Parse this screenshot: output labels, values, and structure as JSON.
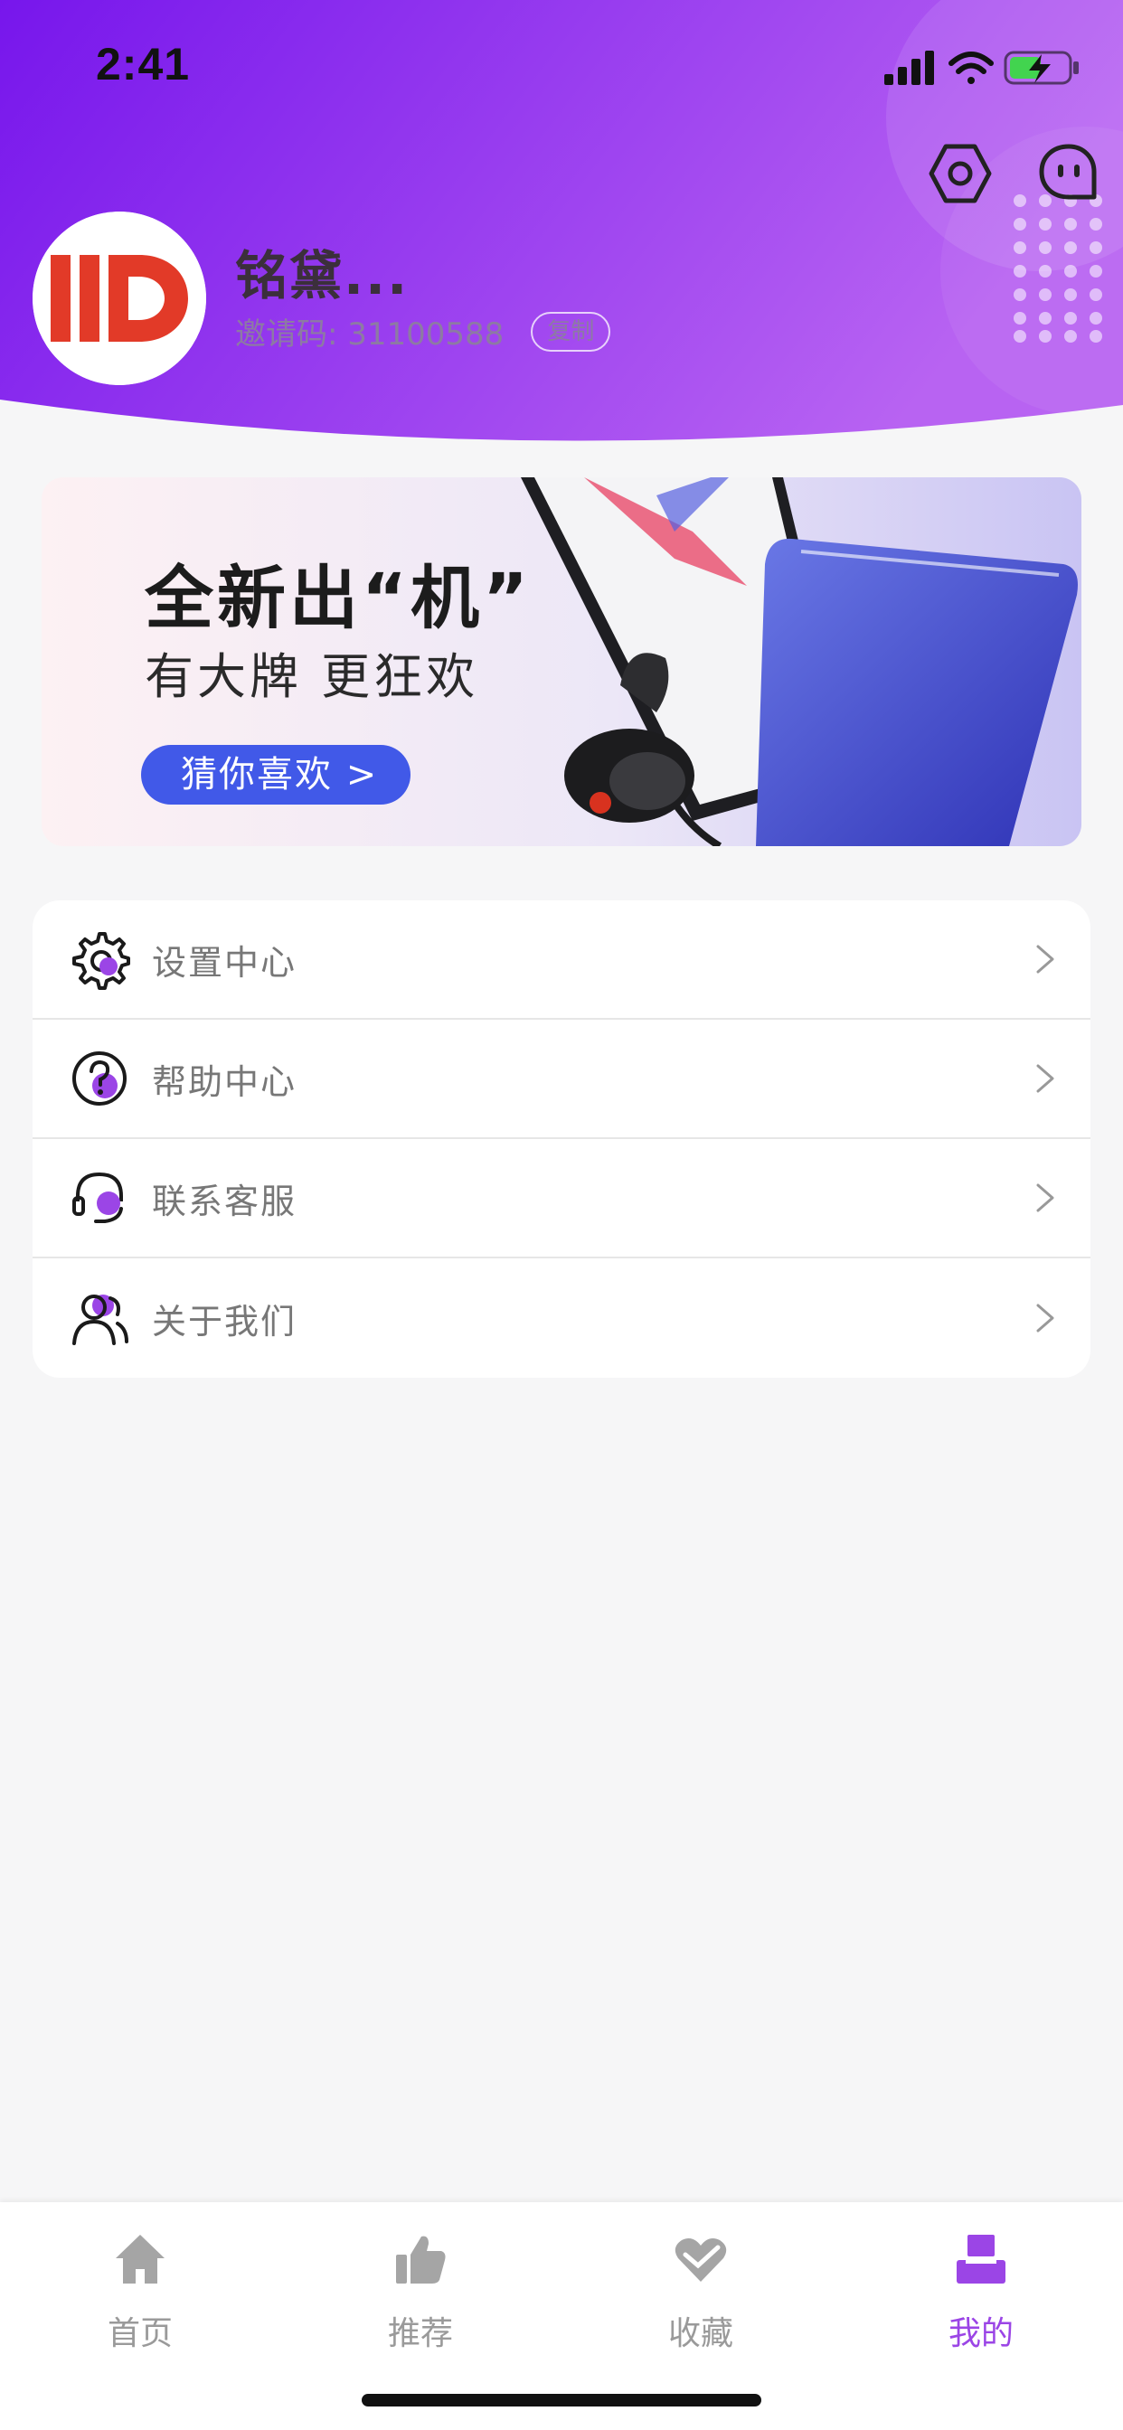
{
  "status_bar": {
    "time": "2:41"
  },
  "profile": {
    "name": "铭黛...",
    "invite_label": "邀请码: 31100588",
    "copy_label": "复制"
  },
  "banner": {
    "title": "全新出“机”",
    "subtitle": "有大牌 更狂欢",
    "button_label": "猜你喜欢 >"
  },
  "menu": {
    "items": [
      {
        "label": "设置中心",
        "icon": "gear-icon"
      },
      {
        "label": "帮助中心",
        "icon": "help-icon"
      },
      {
        "label": "联系客服",
        "icon": "headset-icon"
      },
      {
        "label": "关于我们",
        "icon": "users-icon"
      }
    ]
  },
  "tabbar": {
    "tabs": [
      {
        "label": "首页",
        "icon": "home-icon"
      },
      {
        "label": "推荐",
        "icon": "thumbs-up-icon"
      },
      {
        "label": "收藏",
        "icon": "heart-icon"
      },
      {
        "label": "我的",
        "icon": "profile-icon"
      }
    ],
    "active_index": 3
  },
  "colors": {
    "accent": "#9b45e6",
    "header_gradient_start": "#7a18ee",
    "header_gradient_end": "#b65ef2",
    "banner_button": "#4159e8"
  }
}
